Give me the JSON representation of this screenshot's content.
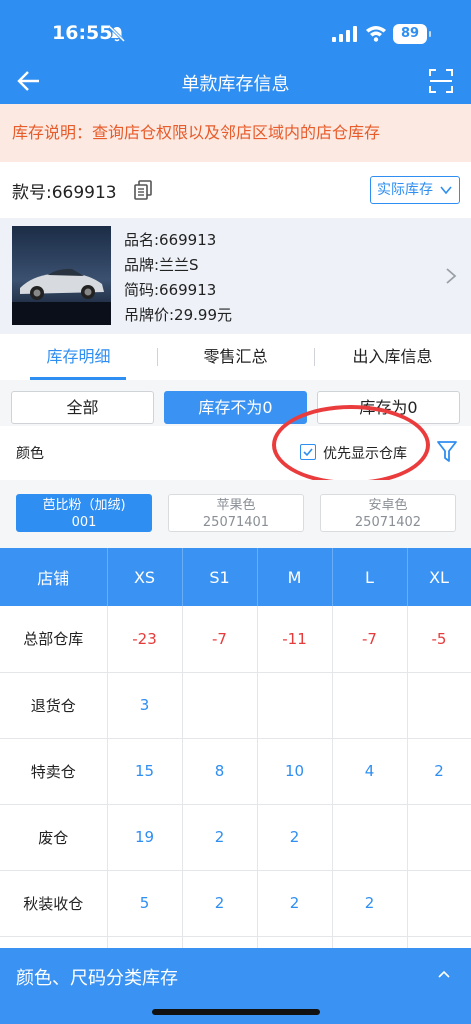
{
  "status_bar": {
    "time": "16:55",
    "battery": "89"
  },
  "header": {
    "title": "单款库存信息"
  },
  "notice": {
    "text": "库存说明：查询店仓权限以及邻店区域内的店仓库存"
  },
  "sku": {
    "label": "款号:669913",
    "stock_select_value": "实际库存"
  },
  "product": {
    "name": "品名:669913",
    "brand": "品牌:兰兰S",
    "code": "简码:669913",
    "price": "吊牌价:29.99元"
  },
  "tabs": [
    {
      "label": "库存明细",
      "active": true
    },
    {
      "label": "零售汇总",
      "active": false
    },
    {
      "label": "出入库信息",
      "active": false
    }
  ],
  "filters": [
    {
      "label": "全部",
      "active": false
    },
    {
      "label": "库存不为0",
      "active": true
    },
    {
      "label": "库存为0",
      "active": false
    }
  ],
  "color_section": {
    "label": "颜色",
    "checkbox_label": "优先显示仓库",
    "checkbox_checked": true
  },
  "swatches": [
    {
      "name": "芭比粉（加绒)",
      "code": "001",
      "active": true
    },
    {
      "name": "苹果色",
      "code": "25071401",
      "active": false
    },
    {
      "name": "安卓色",
      "code": "25071402",
      "active": false
    }
  ],
  "table": {
    "headers": [
      "店铺",
      "XS",
      "S1",
      "M",
      "L",
      "XL"
    ],
    "rows": [
      {
        "store": "总部仓库",
        "values": [
          "-23",
          "-7",
          "-11",
          "-7",
          "-5"
        ]
      },
      {
        "store": "退货仓",
        "values": [
          "3",
          "",
          "",
          "",
          ""
        ]
      },
      {
        "store": "特卖仓",
        "values": [
          "15",
          "8",
          "10",
          "4",
          "2"
        ]
      },
      {
        "store": "废仓",
        "values": [
          "19",
          "2",
          "2",
          "",
          ""
        ]
      },
      {
        "store": "秋装收仓",
        "values": [
          "5",
          "2",
          "2",
          "2",
          ""
        ]
      },
      {
        "store": "夏装收仓",
        "values": [
          "4",
          "2",
          "1",
          "",
          ""
        ]
      }
    ]
  },
  "bottom_bar": {
    "text": "颜色、尺码分类库存"
  },
  "colors": {
    "primary": "#2f8ef1",
    "notice_text": "#e85b2a",
    "negative": "#e63b3b",
    "annotation": "#ea3c3c"
  }
}
